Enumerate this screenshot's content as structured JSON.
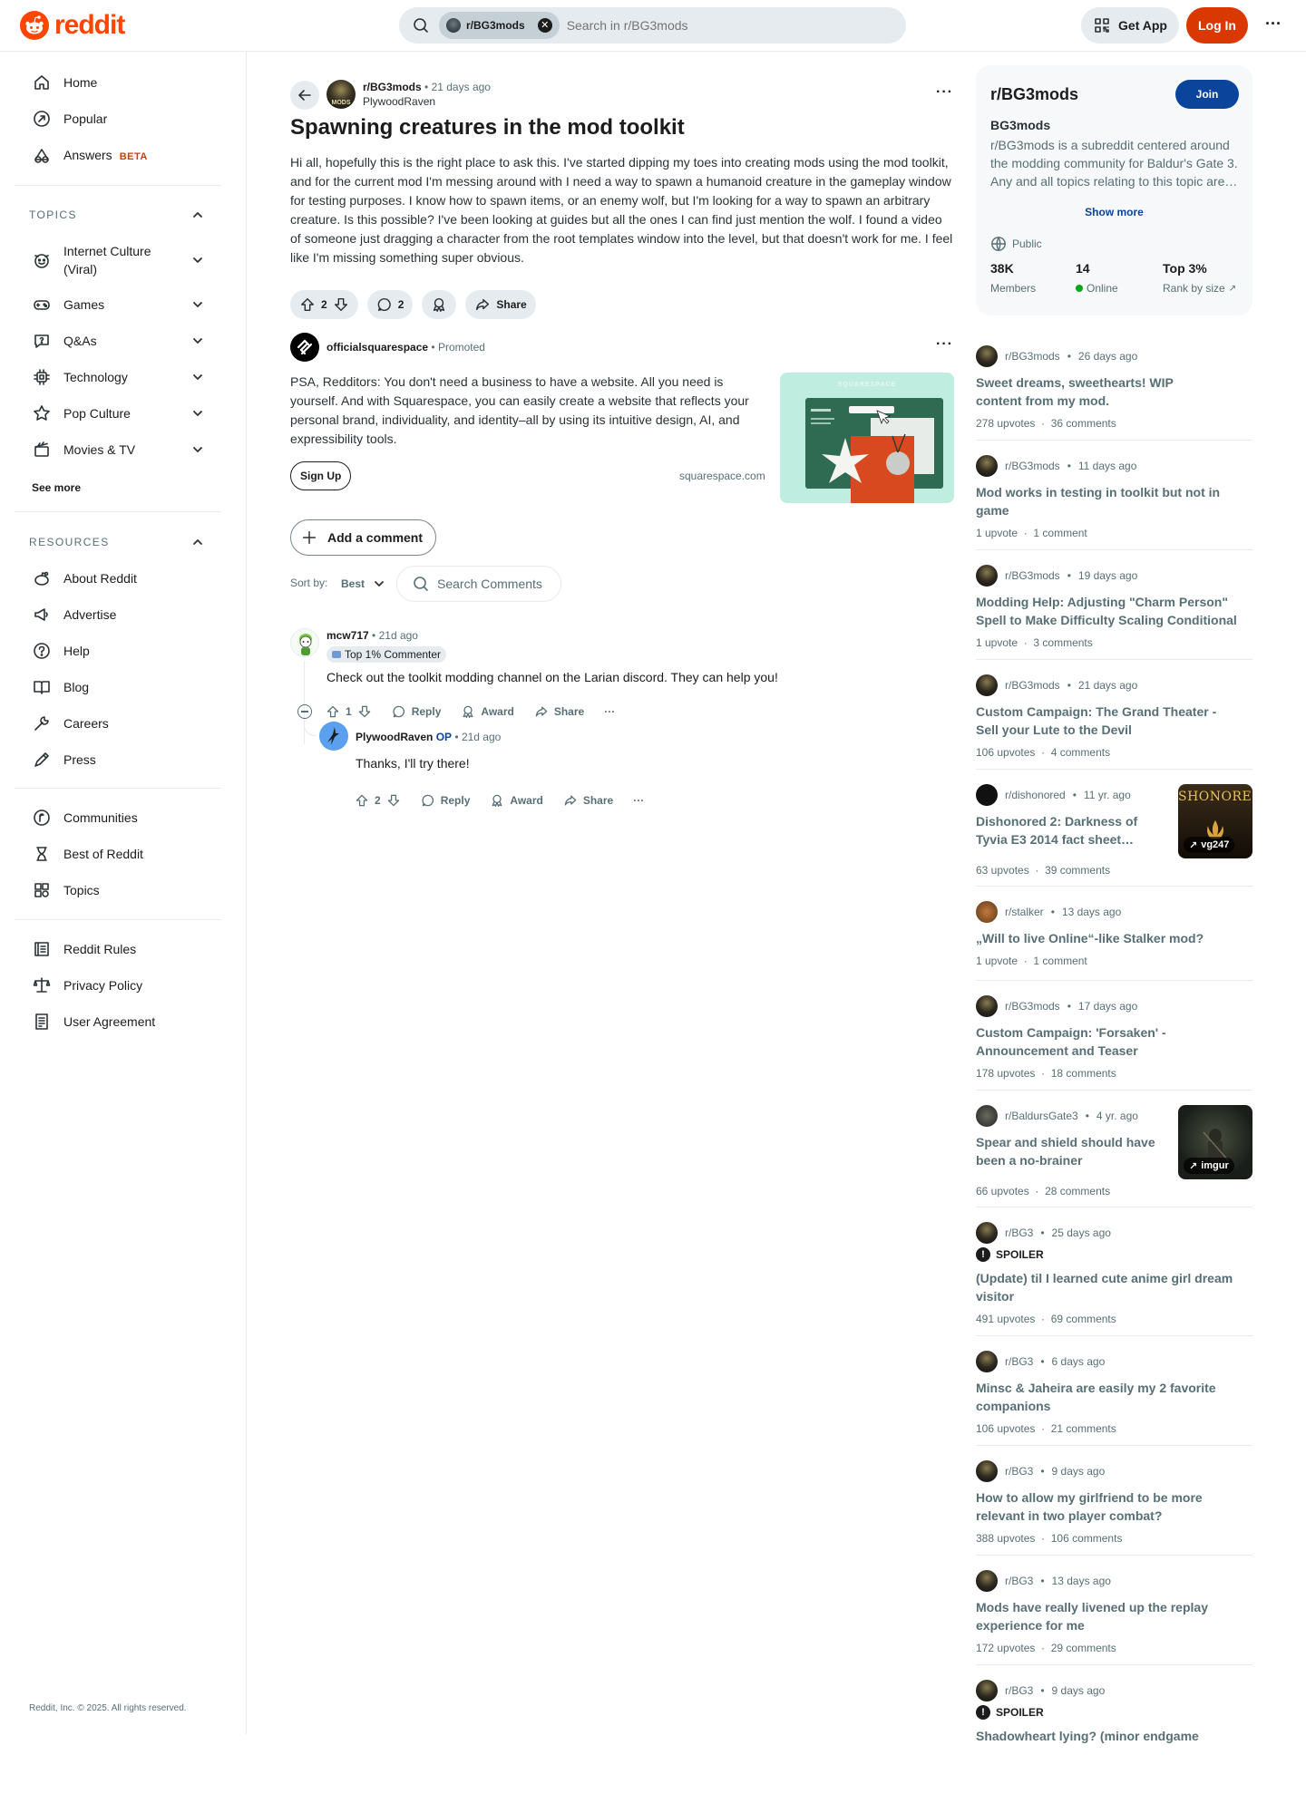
{
  "header": {
    "logo_text": "reddit",
    "search_chip": "r/BG3mods",
    "search_placeholder": "Search in r/BG3mods",
    "get_app": "Get App",
    "login": "Log In",
    "more": "···"
  },
  "sidebar": {
    "top_items": [
      {
        "label": "Home",
        "icon": "home-icon"
      },
      {
        "label": "Popular",
        "icon": "popular-icon"
      },
      {
        "label": "Answers",
        "icon": "answers-icon",
        "badge": "BETA"
      }
    ],
    "topics_heading": "TOPICS",
    "topics": [
      {
        "label": "Internet Culture (Viral)",
        "icon": "internet-culture-icon"
      },
      {
        "label": "Games",
        "icon": "games-icon"
      },
      {
        "label": "Q&As",
        "icon": "qa-icon"
      },
      {
        "label": "Technology",
        "icon": "technology-icon"
      },
      {
        "label": "Pop Culture",
        "icon": "pop-culture-icon"
      },
      {
        "label": "Movies & TV",
        "icon": "movies-icon"
      }
    ],
    "see_more": "See more",
    "resources_heading": "RESOURCES",
    "resources": [
      {
        "label": "About Reddit",
        "icon": "about-icon"
      },
      {
        "label": "Advertise",
        "icon": "advertise-icon"
      },
      {
        "label": "Help",
        "icon": "help-icon"
      },
      {
        "label": "Blog",
        "icon": "blog-icon"
      },
      {
        "label": "Careers",
        "icon": "careers-icon"
      },
      {
        "label": "Press",
        "icon": "press-icon"
      }
    ],
    "more_items": [
      {
        "label": "Communities",
        "icon": "communities-icon"
      },
      {
        "label": "Best of Reddit",
        "icon": "best-of-icon"
      },
      {
        "label": "Topics",
        "icon": "topics-icon"
      }
    ],
    "policy_items": [
      {
        "label": "Reddit Rules",
        "icon": "rules-icon"
      },
      {
        "label": "Privacy Policy",
        "icon": "privacy-icon"
      },
      {
        "label": "User Agreement",
        "icon": "agreement-icon"
      }
    ],
    "copyright": "Reddit, Inc. © 2025. All rights reserved."
  },
  "post": {
    "subreddit": "r/BG3mods",
    "time": "21 days ago",
    "author": "PlywoodRaven",
    "avatar_text": "MODS",
    "title": "Spawning creatures in the mod toolkit",
    "body": "Hi all, hopefully this is the right place to ask this. I've started dipping my toes into creating mods using the mod toolkit, and for the current mod I'm messing around with I need a way to spawn a humanoid creature in the gameplay window for testing purposes. I know how to spawn items, or an enemy wolf, but I'm looking for a way to spawn an arbitrary creature. Is this possible? I've been looking at guides but all the ones I can find just mention the wolf. I found a video of someone just dragging a character from the root templates window into the level, but that doesn't work for me. I feel like I'm missing something super obvious.",
    "votes": "2",
    "comments": "2",
    "share": "Share"
  },
  "ad": {
    "name": "officialsquarespace",
    "tag": "Promoted",
    "body": "PSA, Redditors: You don't need a business to have a website. All you need is yourself. And with Squarespace, you can easily create a website that reflects your personal brand, individuality, and identity–all by using its intuitive design, AI, and expressibility tools.",
    "cta": "Sign Up",
    "domain": "squarespace.com",
    "thumb_brand": "SQUARESPACE"
  },
  "comments_section": {
    "add_comment": "Add a comment",
    "sort_label": "Sort by:",
    "sort_value": "Best",
    "search_placeholder": "Search Comments"
  },
  "comments": [
    {
      "user": "mcw717",
      "time": "21d ago",
      "badge": "Top 1% Commenter",
      "body": "Check out the toolkit modding channel on the Larian discord. They can help you!",
      "votes": "1",
      "reply": "Reply",
      "award": "Award",
      "share": "Share"
    },
    {
      "user": "PlywoodRaven",
      "op": "OP",
      "time": "21d ago",
      "body": "Thanks, I'll try there!",
      "votes": "2",
      "reply": "Reply",
      "award": "Award",
      "share": "Share"
    }
  ],
  "community": {
    "name": "r/BG3mods",
    "join": "Join",
    "title": "BG3mods",
    "description": "r/BG3mods is a subreddit centered around the modding community for Baldur's Gate 3. Any and all topics relating to this topic are…",
    "show_more": "Show more",
    "visibility": "Public",
    "members_value": "38K",
    "members_label": "Members",
    "online_value": "14",
    "online_label": "Online",
    "rank_value": "Top 3%",
    "rank_label": "Rank by size"
  },
  "related_posts": [
    {
      "sub": "r/BG3mods",
      "time": "26 days ago",
      "title": "Sweet dreams, sweethearts! WIP content from my mod.",
      "upvotes": "278 upvotes",
      "comments": "36 comments"
    },
    {
      "sub": "r/BG3mods",
      "time": "11 days ago",
      "title": "Mod works in testing in toolkit but not in game",
      "upvotes": "1 upvote",
      "comments": "1 comment"
    },
    {
      "sub": "r/BG3mods",
      "time": "19 days ago",
      "title": "Modding Help: Adjusting \"Charm Person\" Spell to Make Difficulty Scaling Conditional",
      "upvotes": "1 upvote",
      "comments": "3 comments"
    },
    {
      "sub": "r/BG3mods",
      "time": "21 days ago",
      "title": "Custom Campaign: The Grand Theater - Sell your Lute to the Devil",
      "upvotes": "106 upvotes",
      "comments": "4 comments"
    },
    {
      "sub": "r/dishonored",
      "time": "11 yr. ago",
      "title": "Dishonored 2: Darkness of Tyvia E3 2014 fact sheet…",
      "upvotes": "63 upvotes",
      "comments": "39 comments",
      "thumb": "vg247",
      "thumb_text": "SHONORED"
    },
    {
      "sub": "r/stalker",
      "time": "13 days ago",
      "title": "„Will to live Online“-like Stalker mod?",
      "upvotes": "1 upvote",
      "comments": "1 comment"
    },
    {
      "sub": "r/BG3mods",
      "time": "17 days ago",
      "title": "Custom Campaign: 'Forsaken' - Announcement and Teaser",
      "upvotes": "178 upvotes",
      "comments": "18 comments"
    },
    {
      "sub": "r/BaldursGate3",
      "time": "4 yr. ago",
      "title": "Spear and shield should have been a no-brainer",
      "upvotes": "66 upvotes",
      "comments": "28 comments",
      "thumb": "imgur"
    },
    {
      "sub": "r/BG3",
      "time": "25 days ago",
      "spoiler": "SPOILER",
      "title": "(Update) til I learned cute anime girl dream visitor",
      "upvotes": "491 upvotes",
      "comments": "69 comments"
    },
    {
      "sub": "r/BG3",
      "time": "6 days ago",
      "title": "Minsc & Jaheira are easily my 2 favorite companions",
      "upvotes": "106 upvotes",
      "comments": "21 comments"
    },
    {
      "sub": "r/BG3",
      "time": "9 days ago",
      "title": "How to allow my girlfriend to be more relevant in two player combat?",
      "upvotes": "388 upvotes",
      "comments": "106 comments"
    },
    {
      "sub": "r/BG3",
      "time": "13 days ago",
      "title": "Mods have really livened up the replay experience for me",
      "upvotes": "172 upvotes",
      "comments": "29 comments"
    },
    {
      "sub": "r/BG3",
      "time": "9 days ago",
      "spoiler": "SPOILER",
      "title": "Shadowheart lying? (minor endgame",
      "upvotes": "",
      "comments": ""
    }
  ],
  "colors": {
    "brand": "#ff4500",
    "login": "#d93900",
    "join": "#0a449b",
    "online": "#01a816"
  }
}
